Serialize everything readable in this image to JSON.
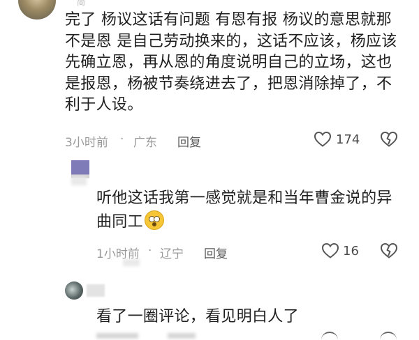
{
  "comments": [
    {
      "username_peek": "简",
      "text": "完了  杨议这话有问题  有恩有报  杨议的意思就那不是恩  是自己劳动换来的，这话不应该，杨应该先确立恩，再从恩的角度说明自己的立场，这也是报恩，杨被节奏绕进去了，把恩消除掉了，不利于人设。",
      "time": "3小时前",
      "location": "广东",
      "separator": "·",
      "reply_label": "回复",
      "likes": "174"
    },
    {
      "text": "听他这话我第一感觉就是和当年曹金说的异曲同工",
      "emoji": "astonished-face",
      "time": "1小时前",
      "location": "辽宁",
      "separator": "·",
      "reply_label": "回复",
      "likes": "16"
    },
    {
      "text": "看了一圈评论，看见明白人了"
    }
  ],
  "colors": {
    "text": "#1f1f1f",
    "meta": "#9a9a9a",
    "icon": "#555555"
  }
}
